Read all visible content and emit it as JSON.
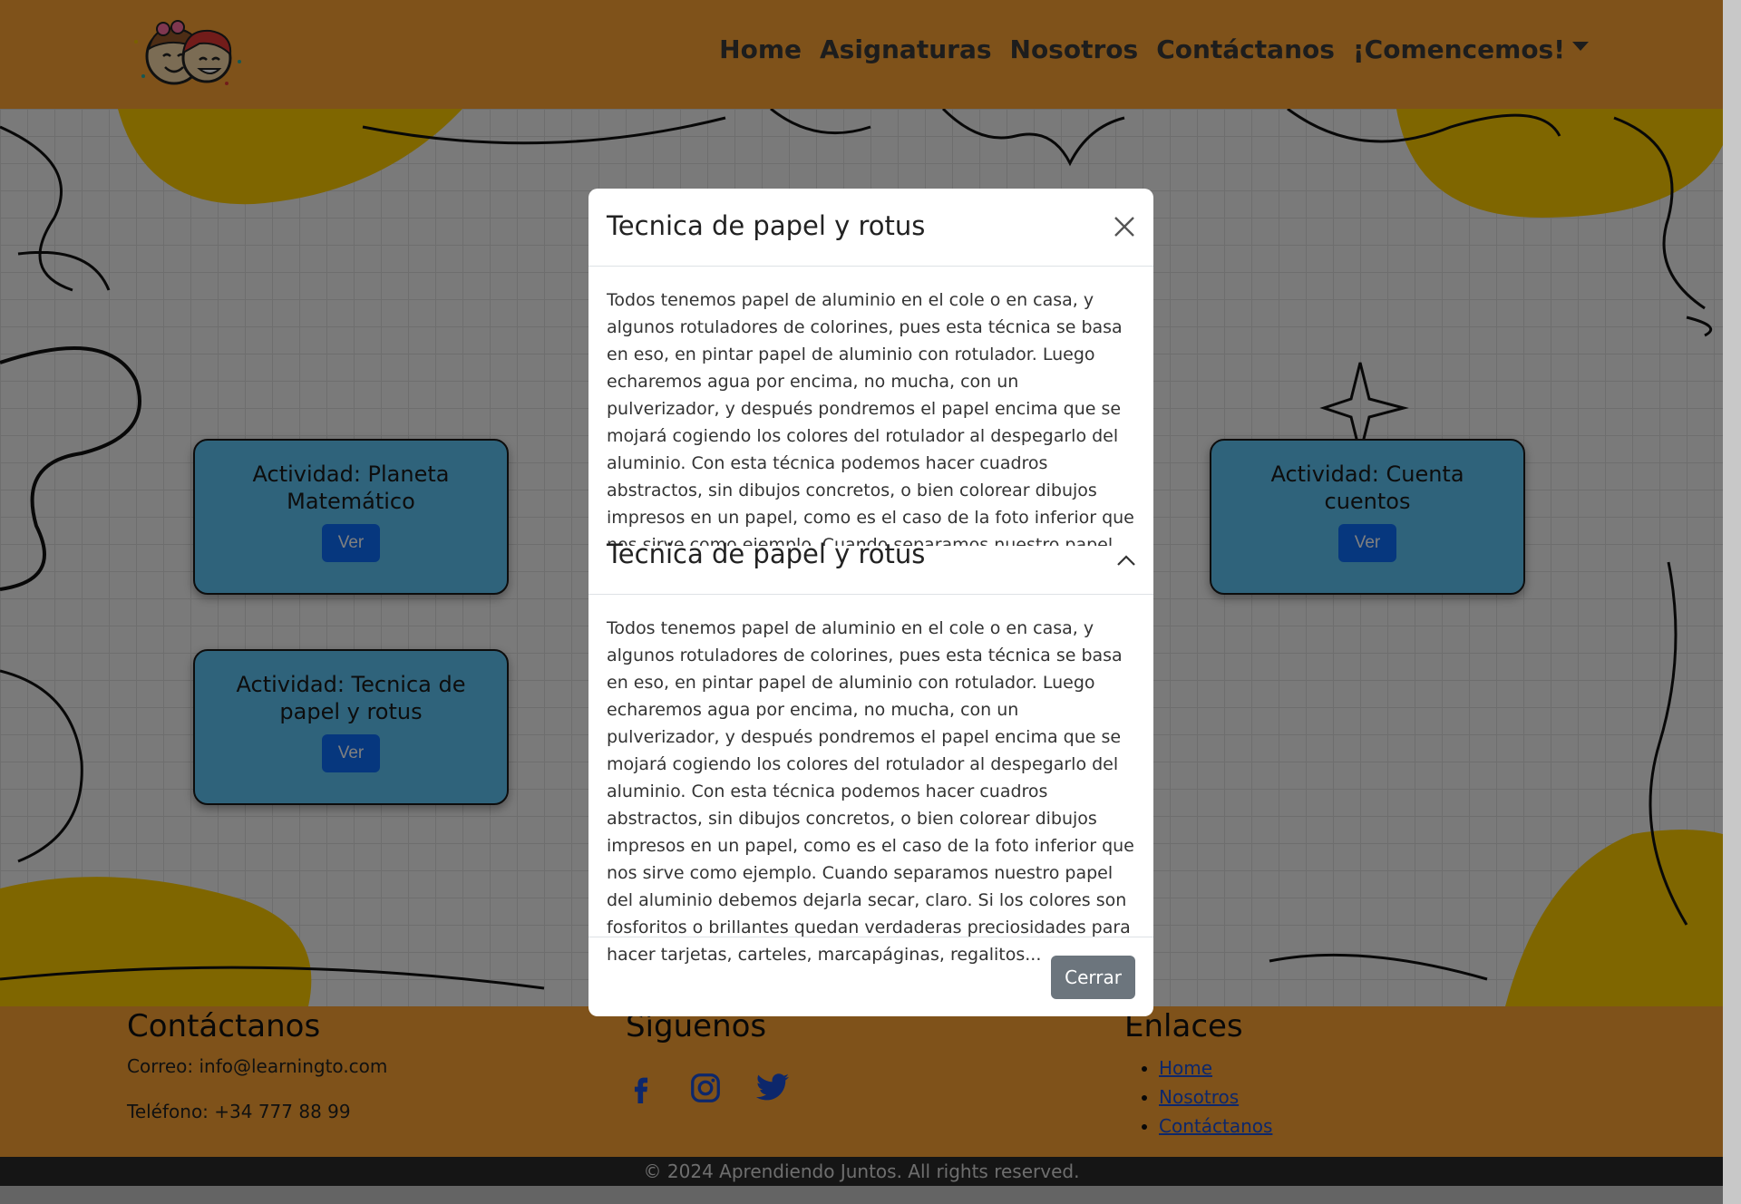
{
  "navbar": {
    "links": [
      "Home",
      "Asignaturas",
      "Nosotros",
      "Contáctanos",
      "¡Comencemos!"
    ],
    "bg_color": "#ffa534"
  },
  "cards": [
    {
      "title": "Actividad: Planeta Matemático",
      "button": "Ver"
    },
    {
      "title": "Actividad: Tecnica de papel y rotus",
      "button": "Ver"
    },
    {
      "title": "Actividad: Cuenta cuentos",
      "button": "Ver"
    }
  ],
  "modal": {
    "title": "Tecnica de papel y rotus",
    "body_text": "Todos tenemos papel de aluminio en el cole o en casa, y algunos rotuladores de colorines, pues esta técnica se basa en eso, en pintar papel de aluminio con rotulador. Luego echaremos agua por encima, no mucha, con un pulverizador, y después pondremos el papel encima que se mojará cogiendo los colores del rotulador al despegarlo del aluminio. Con esta técnica podemos hacer cuadros abstractos, sin dibujos concretos, o bien colorear dibujos impresos en un papel, como es el caso de la foto inferior que nos sirve como ejemplo. Cuando separamos nuestro papel del aluminio debemos dejarla secar, claro. Si los colores son fosforitos o brillantes quedan verdaderas preciosidades para hacer tarjetas, carteles, marcapáginas, regalitos...",
    "accordion_title": "Tecnica de papel y rotus",
    "accordion_text": "Todos tenemos papel de aluminio en el cole o en casa, y algunos rotuladores de colorines, pues esta técnica se basa en eso, en pintar papel de aluminio con rotulador. Luego echaremos agua por encima, no mucha, con un pulverizador, y después pondremos el papel encima que se mojará cogiendo los colores del rotulador al despegarlo del aluminio. Con esta técnica podemos hacer cuadros abstractos, sin dibujos concretos, o bien colorear dibujos impresos en un papel, como es el caso de la foto inferior que nos sirve como ejemplo. Cuando separamos nuestro papel del aluminio debemos dejarla secar, claro. Si los colores son fosforitos o brillantes quedan verdaderas preciosidades para hacer tarjetas, carteles, marcapáginas, regalitos...",
    "close_label": "Cerrar"
  },
  "footer": {
    "contact": {
      "heading": "Contáctanos",
      "email": "Correo: info@learningto.com",
      "phone": "Teléfono: +34 777 88 99"
    },
    "social": {
      "heading": "Síguenos",
      "icons": [
        "facebook-icon",
        "instagram-icon",
        "twitter-icon"
      ]
    },
    "links": {
      "heading": "Enlaces",
      "items": [
        "Home",
        "Nosotros",
        "Contáctanos"
      ]
    }
  },
  "copyright": "© 2024 Aprendiendo Juntos. All rights reserved."
}
